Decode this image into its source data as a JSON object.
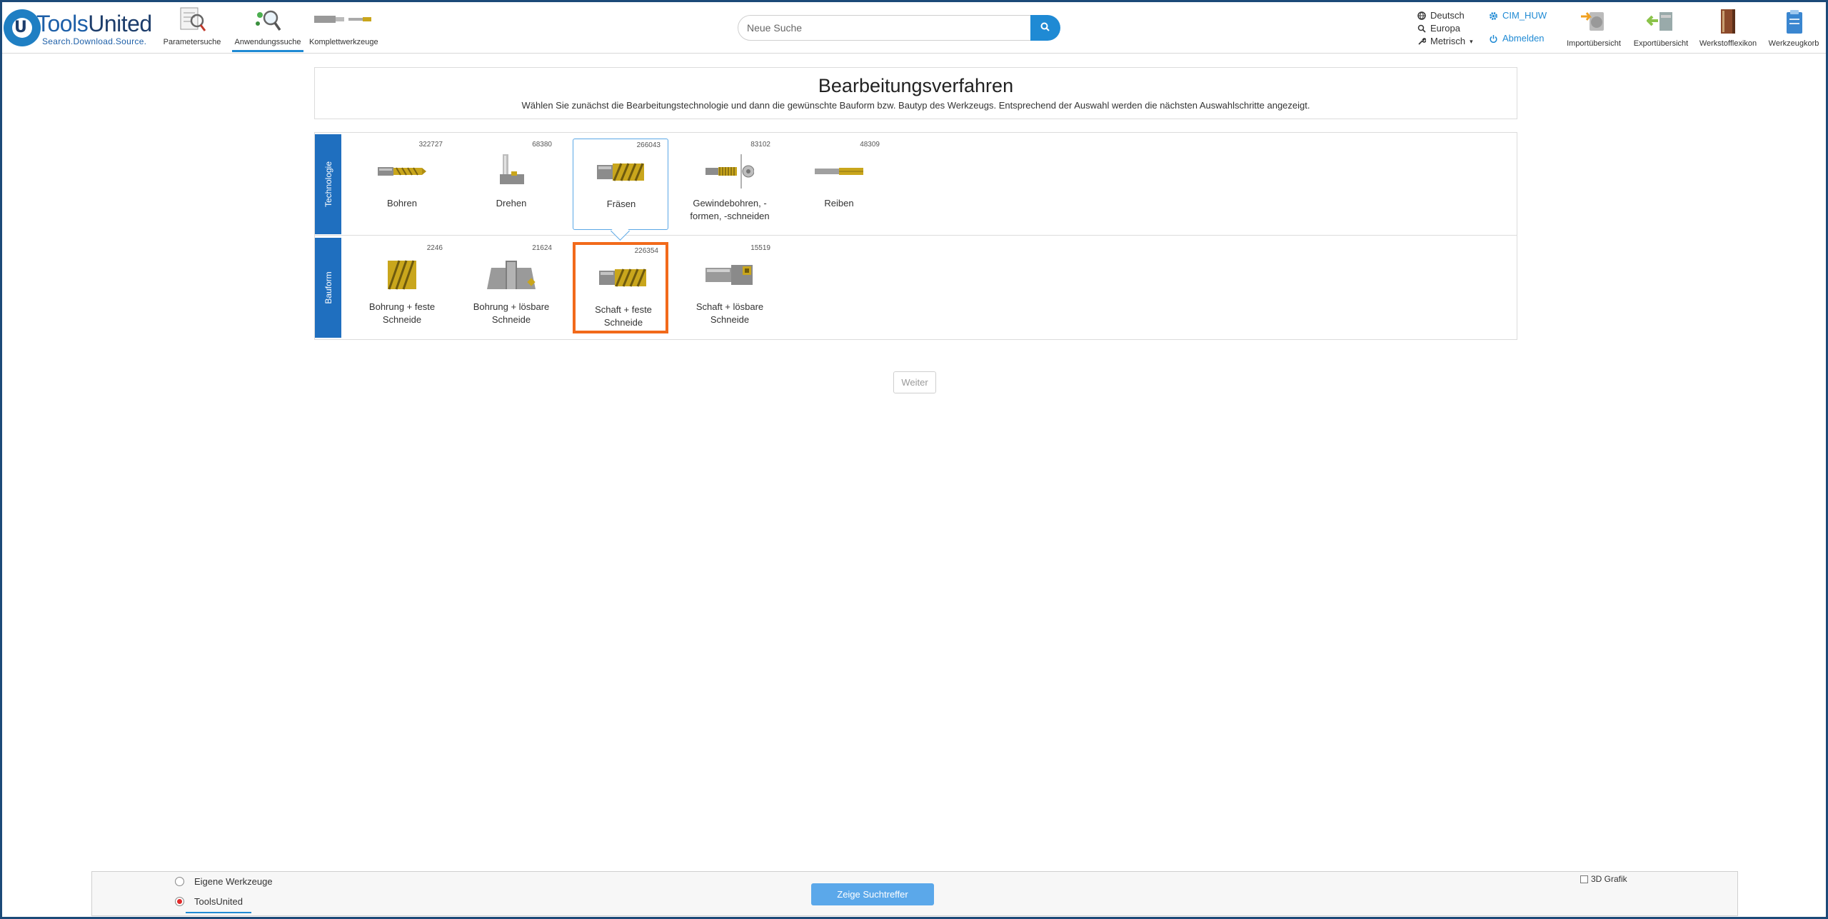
{
  "header": {
    "logo": {
      "name_a": "Tools",
      "name_b": "United",
      "tagline": "Search.Download.Source.",
      "mark": "U"
    },
    "nav": [
      {
        "label": "Parametersuche",
        "icon": "parameter-search-icon"
      },
      {
        "label": "Anwendungssuche",
        "icon": "application-search-icon",
        "active": true
      },
      {
        "label": "Komplettwerkzeuge",
        "icon": "complete-tools-icon"
      }
    ],
    "search": {
      "placeholder": "Neue Suche",
      "value": ""
    },
    "prefs": {
      "language": "Deutsch",
      "region": "Europa",
      "units": "Metrisch"
    },
    "user": {
      "name": "CIM_HUW",
      "logout": "Abmelden"
    },
    "tools": [
      {
        "label": "Importübersicht",
        "icon": "import-overview-icon"
      },
      {
        "label": "Exportübersicht",
        "icon": "export-overview-icon"
      },
      {
        "label": "Werkstofflexikon",
        "icon": "material-lexicon-icon"
      },
      {
        "label": "Werkzeugkorb",
        "icon": "tool-basket-icon"
      }
    ]
  },
  "main": {
    "title": "Bearbeitungsverfahren",
    "subtitle": "Wählen Sie zunächst die Bearbeitungstechnologie und dann die gewünschte Bauform bzw. Bautyp des Werkzeugs. Entsprechend der Auswahl werden die nächsten Auswahlschritte angezeigt.",
    "technologie": {
      "label": "Technologie",
      "items": [
        {
          "label": "Bohren",
          "count": "322727"
        },
        {
          "label": "Drehen",
          "count": "68380"
        },
        {
          "label": "Fräsen",
          "count": "266043",
          "selected": true
        },
        {
          "label": "Gewindebohren, -formen, -schneiden",
          "count": "83102"
        },
        {
          "label": "Reiben",
          "count": "48309"
        }
      ]
    },
    "bauform": {
      "label": "Bauform",
      "items": [
        {
          "label": "Bohrung + feste Schneide",
          "count": "2246"
        },
        {
          "label": "Bohrung + lösbare Schneide",
          "count": "21624"
        },
        {
          "label": "Schaft + feste Schneide",
          "count": "226354",
          "selected": true
        },
        {
          "label": "Schaft + lösbare Schneide",
          "count": "15519"
        }
      ]
    },
    "next_button": "Weiter"
  },
  "footer": {
    "radio_own": "Eigene Werkzeuge",
    "radio_tu": "ToolsUnited",
    "show_button": "Zeige Suchtreffer",
    "grafik_label": "3D Grafik"
  },
  "colors": {
    "accent": "#1f8ad4",
    "row_label": "#1f6fbf",
    "highlight": "#f26a1b",
    "tool_gold": "#c9a61c"
  }
}
